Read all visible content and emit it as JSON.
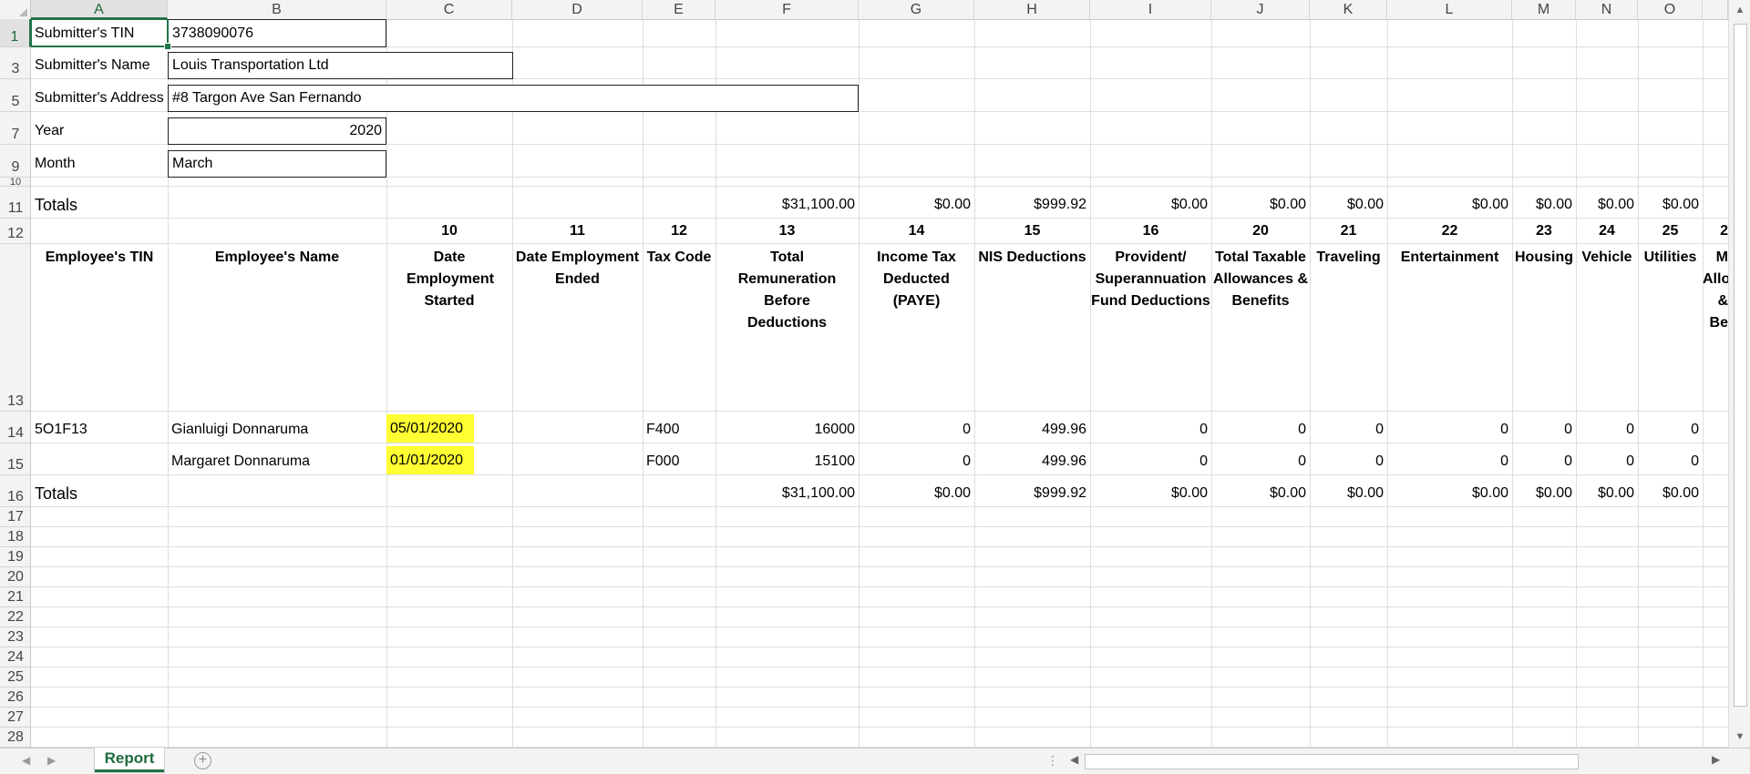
{
  "columns": [
    "A",
    "B",
    "C",
    "D",
    "E",
    "F",
    "G",
    "H",
    "I",
    "J",
    "K",
    "L",
    "M",
    "N",
    "O"
  ],
  "row_numbers": [
    "1",
    "3",
    "5",
    "7",
    "9",
    "10",
    "11",
    "12",
    "13",
    "14",
    "15",
    "16",
    "17",
    "18",
    "19",
    "20",
    "21",
    "22",
    "23",
    "24",
    "25",
    "26",
    "27",
    "28"
  ],
  "submitter": {
    "tin_label": "Submitter's TIN",
    "tin_value": "3738090076",
    "name_label": "Submitter's Name",
    "name_value": "Louis Transportation Ltd",
    "address_label": "Submitter's Address",
    "address_value": "#8 Targon Ave San Fernando",
    "year_label": "Year",
    "year_value": "2020",
    "month_label": "Month",
    "month_value": "March"
  },
  "totals_label": "Totals",
  "totals_top": [
    "$31,100.00",
    "$0.00",
    "$999.92",
    "$0.00",
    "$0.00",
    "$0.00",
    "$0.00",
    "$0.00",
    "$0.00",
    "$0.00"
  ],
  "field_numbers": [
    "10",
    "11",
    "12",
    "13",
    "14",
    "15",
    "16",
    "20",
    "21",
    "22",
    "23",
    "24",
    "25",
    "2"
  ],
  "headers": {
    "employee_tin": "Employee's TIN",
    "employee_name": "Employee's Name",
    "cols": [
      "Date Employment Started",
      "Date Employment Ended",
      "Tax Code",
      "Total Remuneration Before Deductions",
      "Income Tax Deducted (PAYE)",
      "NIS Deductions",
      "Provident/ Superannuation Fund Deductions",
      "Total Taxable Allowances & Benefits",
      "Traveling",
      "Entertainment",
      "Housing",
      "Vehicle",
      "Utilities",
      "M Allow & Be"
    ]
  },
  "employees": [
    {
      "tin": "5O1F13",
      "name": "Gianluigi Donnaruma",
      "start": "05/01/2020",
      "end": "",
      "tax_code": "F400",
      "values": [
        "16000",
        "0",
        "499.96",
        "0",
        "0",
        "0",
        "0",
        "0",
        "0",
        "0"
      ]
    },
    {
      "tin": "",
      "name": "Margaret Donnaruma",
      "start": "01/01/2020",
      "end": "",
      "tax_code": "F000",
      "values": [
        "15100",
        "0",
        "499.96",
        "0",
        "0",
        "0",
        "0",
        "0",
        "0",
        "0"
      ]
    }
  ],
  "totals_bottom": [
    "$31,100.00",
    "$0.00",
    "$999.92",
    "$0.00",
    "$0.00",
    "$0.00",
    "$0.00",
    "$0.00",
    "$0.00",
    "$0.00"
  ],
  "sheet_tab": "Report",
  "add_sheet_symbol": "+",
  "colors": {
    "accent": "#217346",
    "highlight": "#ffff33"
  }
}
